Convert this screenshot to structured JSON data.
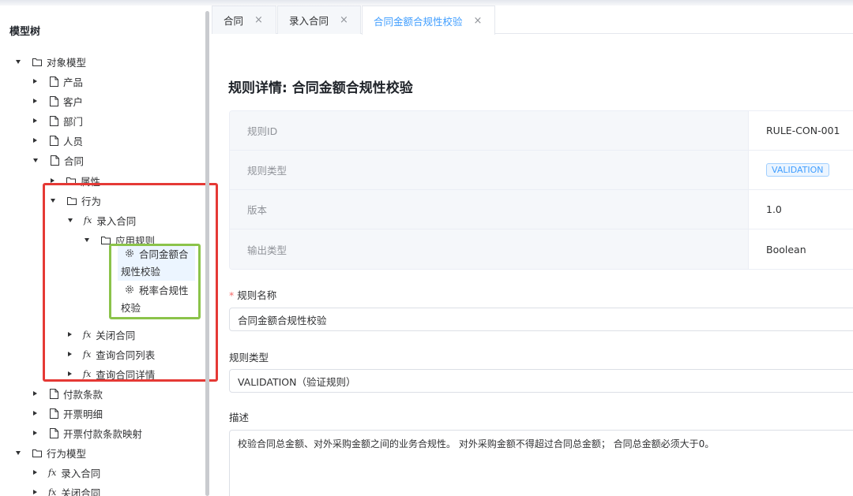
{
  "sidebar": {
    "title": "模型树",
    "tree": [
      {
        "label": "对象模型",
        "icon": "folder-icon",
        "caret": "down"
      },
      {
        "label": "产品",
        "icon": "file-icon",
        "caret": "right"
      },
      {
        "label": "客户",
        "icon": "file-icon",
        "caret": "right"
      },
      {
        "label": "部门",
        "icon": "file-icon",
        "caret": "right"
      },
      {
        "label": "人员",
        "icon": "file-icon",
        "caret": "right"
      },
      {
        "label": "合同",
        "icon": "file-icon",
        "caret": "down"
      },
      {
        "label": "属性",
        "icon": "folder-icon",
        "caret": "right"
      },
      {
        "label": "行为",
        "icon": "folder-icon",
        "caret": "down"
      },
      {
        "label": "录入合同",
        "icon": "function-icon",
        "caret": "down"
      },
      {
        "label": "应用规则",
        "icon": "folder-icon",
        "caret": "down"
      },
      {
        "label": "关闭合同",
        "icon": "function-icon",
        "caret": "right"
      },
      {
        "label": "查询合同列表",
        "icon": "function-icon",
        "caret": "right"
      },
      {
        "label": "查询合同详情",
        "icon": "function-icon",
        "caret": "right"
      },
      {
        "label": "付款条款",
        "icon": "file-icon",
        "caret": "right"
      },
      {
        "label": "开票明细",
        "icon": "file-icon",
        "caret": "right"
      },
      {
        "label": "开票付款条款映射",
        "icon": "file-icon",
        "caret": "right"
      },
      {
        "label": "行为模型",
        "icon": "folder-icon",
        "caret": "down"
      },
      {
        "label": "录入合同",
        "icon": "function-icon",
        "caret": "right"
      },
      {
        "label": "关闭合同",
        "icon": "function-icon",
        "caret": "right"
      }
    ],
    "rules": [
      {
        "line1": "合同金额合",
        "line2": "规性校验",
        "icon": "gear-icon",
        "selected": true
      },
      {
        "line1": "税率合规性",
        "line2": "校验",
        "icon": "gear-icon",
        "selected": false
      }
    ]
  },
  "tabs": [
    {
      "label": "合同",
      "close": "×"
    },
    {
      "label": "录入合同",
      "close": "×"
    },
    {
      "label": "合同金额合规性校验",
      "close": "×",
      "active": true
    }
  ],
  "main": {
    "title": "规则详情: 合同金额合规性校验",
    "details": [
      {
        "label": "规则ID",
        "value": "RULE-CON-001"
      },
      {
        "label": "规则类型",
        "value": "VALIDATION",
        "tag": true
      },
      {
        "label": "版本",
        "value": "1.0"
      },
      {
        "label": "输出类型",
        "value": "Boolean"
      }
    ],
    "form": {
      "name_label": "规则名称",
      "required_mark": "*",
      "name_value": "合同金额合规性校验",
      "type_label": "规则类型",
      "type_value": "VALIDATION（验证规则）",
      "desc_label": "描述",
      "desc_value": "校验合同总金额、对外采购金额之间的业务合规性。 对外采购金额不得超过合同总金额； 合同总金额必须大于0。"
    }
  },
  "colors": {
    "accent": "#409eff",
    "highlight_red": "#e53935",
    "highlight_green": "#8bc34a"
  }
}
